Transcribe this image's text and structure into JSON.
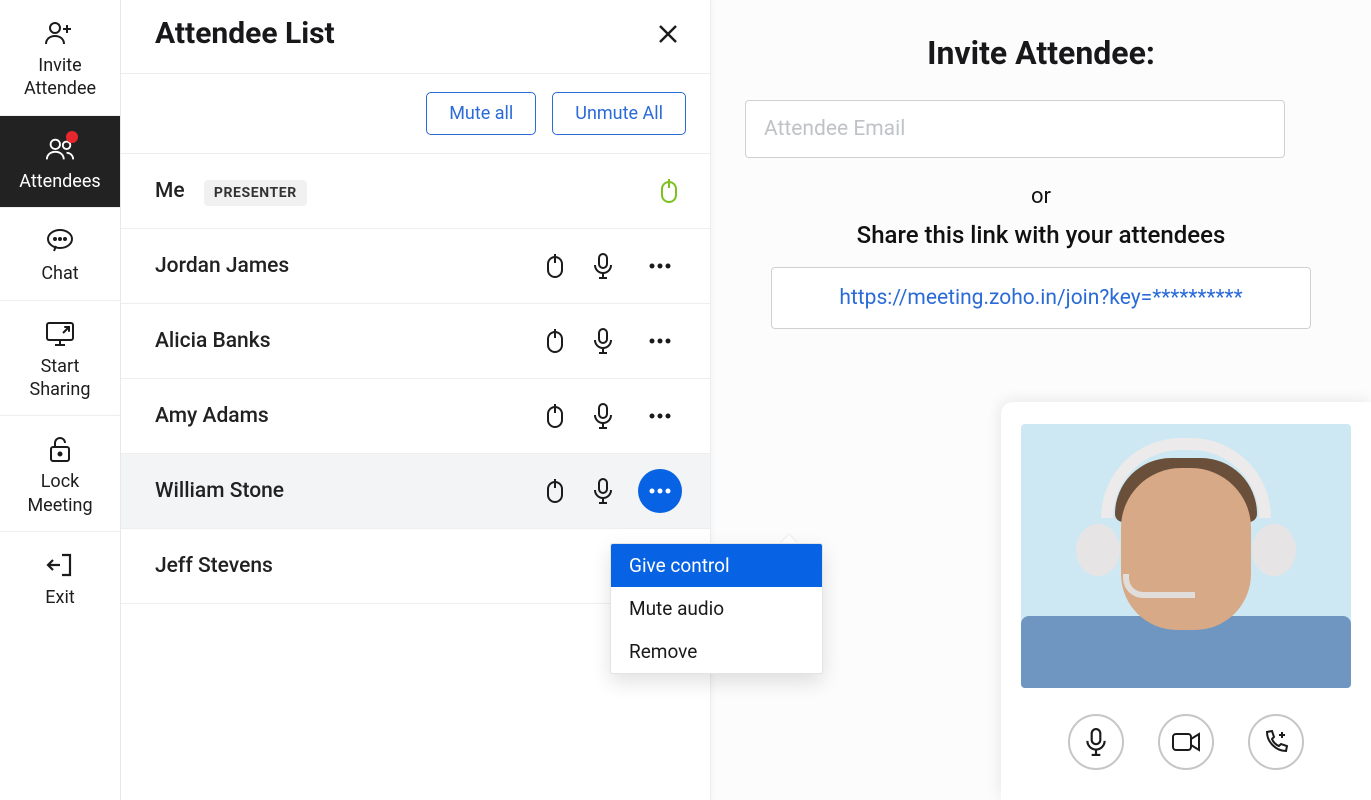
{
  "sidebar": {
    "items": [
      {
        "label": "Invite\nAttendee"
      },
      {
        "label": "Attendees"
      },
      {
        "label": "Chat"
      },
      {
        "label": "Start\nSharing"
      },
      {
        "label": "Lock\nMeeting"
      },
      {
        "label": "Exit"
      }
    ]
  },
  "panel": {
    "title": "Attendee List",
    "mute_all": "Mute all",
    "unmute_all": "Unmute All"
  },
  "attendees": {
    "rows": [
      {
        "name": "Me",
        "badge": "PRESENTER"
      },
      {
        "name": "Jordan James"
      },
      {
        "name": "Alicia Banks"
      },
      {
        "name": "Amy Adams"
      },
      {
        "name": "William Stone"
      },
      {
        "name": "Jeff Stevens"
      }
    ]
  },
  "ctx": {
    "items": [
      "Give control",
      "Mute audio",
      "Remove"
    ]
  },
  "invite": {
    "title": "Invite Attendee:",
    "placeholder": "Attendee Email",
    "or": "or",
    "share_label": "Share this link with your attendees",
    "link": "https://meeting.zoho.in/join?key=**********"
  }
}
